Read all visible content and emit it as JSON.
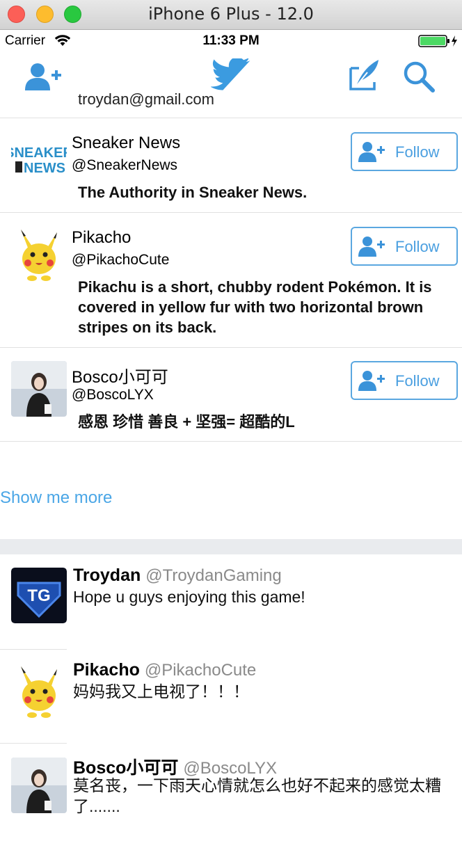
{
  "window": {
    "title": "iPhone 6 Plus - 12.0"
  },
  "status_bar": {
    "carrier": "Carrier",
    "time": "11:33 PM"
  },
  "nav": {
    "left_icon": "add-user-icon",
    "center_icon": "twitter-bird-icon",
    "compose_icon": "compose-icon",
    "search_icon": "search-icon"
  },
  "suggestions": {
    "clipped_text": "troydan@gmail.com",
    "follow_label": "Follow",
    "users": [
      {
        "name": "Sneaker News",
        "handle": "@SneakerNews",
        "bio": "The Authority in Sneaker News.",
        "avatar": "sneaker-news-logo"
      },
      {
        "name": "Pikacho",
        "handle": "@PikachoCute",
        "bio": "Pikachu is a short, chubby rodent Pokémon. It is covered in yellow fur with two horizontal brown stripes on its back.",
        "avatar": "pikachu"
      },
      {
        "name": "Bosco小可可",
        "handle": "@BoscoLYX",
        "bio": "感恩 珍惜 善良 + 坚强= 超酷的L",
        "avatar": "bosco-photo"
      }
    ],
    "show_more": "Show me more"
  },
  "tweets": [
    {
      "name": "Troydan",
      "handle": "@TroydanGaming",
      "text": "Hope u guys enjoying this game!",
      "avatar": "tg-logo"
    },
    {
      "name": "Pikacho",
      "handle": "@PikachoCute",
      "text": "妈妈我又上电视了！！！",
      "avatar": "pikachu"
    },
    {
      "name": "Bosco小可可",
      "handle": "@BoscoLYX",
      "text": "莫名丧，一下雨天心情就怎么也好不起来的感觉太糟了.......",
      "avatar": "bosco-photo"
    }
  ],
  "colors": {
    "accent": "#4aa6e6",
    "twitter_blue": "#1da1f2",
    "divider": "#e1e1e1"
  }
}
